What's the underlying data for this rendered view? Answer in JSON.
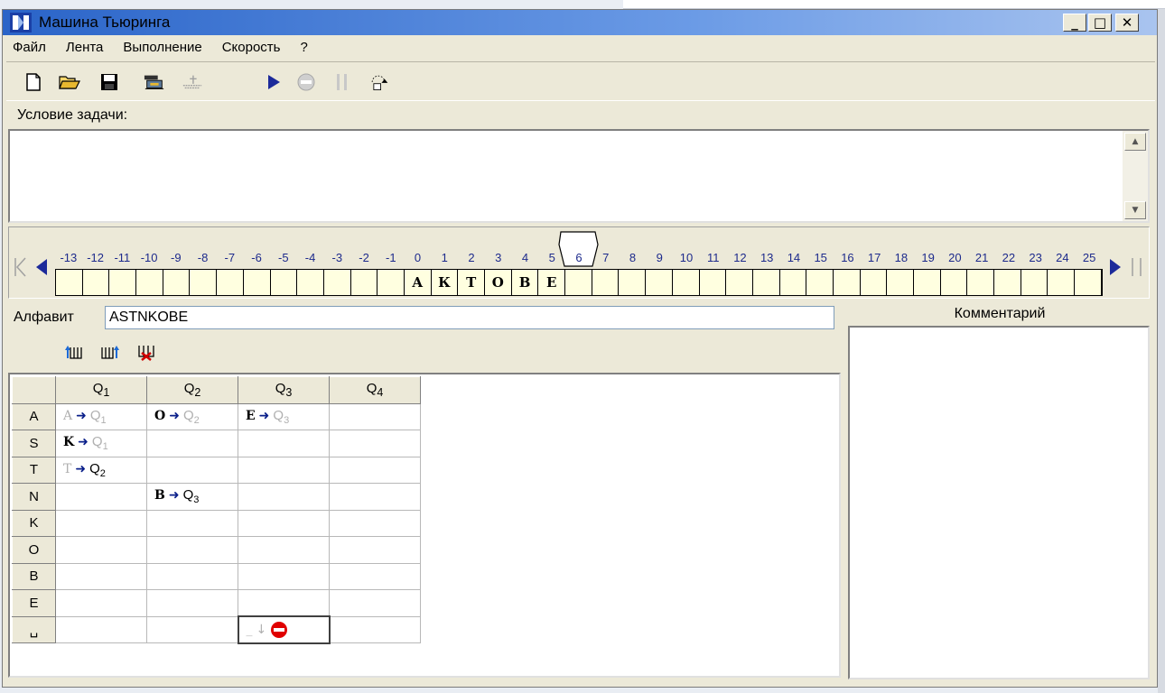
{
  "window": {
    "title": "Машина Тьюринга",
    "controls": {
      "minimize": "_",
      "maximize": "□",
      "close": "✕"
    }
  },
  "menu": [
    "Файл",
    "Лента",
    "Выполнение",
    "Скорость",
    "?"
  ],
  "toolbar": {
    "icons": [
      "new-file-icon",
      "open-folder-icon",
      "save-icon",
      "tape-icon",
      "tape-disabled-icon",
      "run-icon",
      "stop-icon",
      "pause-icon",
      "step-icon"
    ]
  },
  "condition": {
    "label": "Условие задачи:",
    "text": ""
  },
  "tape": {
    "numbers": [
      "-13",
      "-12",
      "-11",
      "-10",
      "-9",
      "-8",
      "-7",
      "-6",
      "-5",
      "-4",
      "-3",
      "-2",
      "-1",
      "0",
      "1",
      "2",
      "3",
      "4",
      "5",
      "6",
      "7",
      "8",
      "9",
      "10",
      "11",
      "12",
      "13",
      "14",
      "15",
      "16",
      "17",
      "18",
      "19",
      "20",
      "21",
      "22",
      "23",
      "24",
      "25"
    ],
    "cells": [
      "",
      "",
      "",
      "",
      "",
      "",
      "",
      "",
      "",
      "",
      "",
      "",
      "",
      "А",
      "К",
      "Т",
      "О",
      "В",
      "Е",
      "",
      "",
      "",
      "",
      "",
      "",
      "",
      "",
      "",
      "",
      "",
      "",
      "",
      "",
      "",
      "",
      "",
      "",
      "",
      ""
    ],
    "head_position": "6"
  },
  "alphabet": {
    "label": "Алфавит",
    "value": "ASTNKOBE"
  },
  "program": {
    "columns": [
      "Q",
      "Q",
      "Q",
      "Q"
    ],
    "column_subs": [
      "1",
      "2",
      "3",
      "4"
    ],
    "rows": [
      "A",
      "S",
      "T",
      "N",
      "K",
      "O",
      "B",
      "E",
      "␣"
    ],
    "cells": {
      "A_Q1": {
        "sym": "A",
        "state": "Q",
        "sub": "1"
      },
      "A_Q2": {
        "sym": "O",
        "state": "Q",
        "sub": "2"
      },
      "A_Q3": {
        "sym": "E",
        "state": "Q",
        "sub": "3"
      },
      "S_Q1": {
        "sym": "K",
        "state": "Q",
        "sub": "1"
      },
      "T_Q1": {
        "sym": "T",
        "state": "Q",
        "sub": "2"
      },
      "N_Q2": {
        "sym": "B",
        "state": "Q",
        "sub": "3"
      },
      "blank_Q3": {
        "sym": "_",
        "move": "↓"
      }
    }
  },
  "comment": {
    "label": "Комментарий",
    "text": ""
  },
  "colors": {
    "title_bar": "#2a64c8",
    "tape_cell": "#ffffe0",
    "arrow": "#0a1f8a",
    "stop": "#e00000"
  }
}
